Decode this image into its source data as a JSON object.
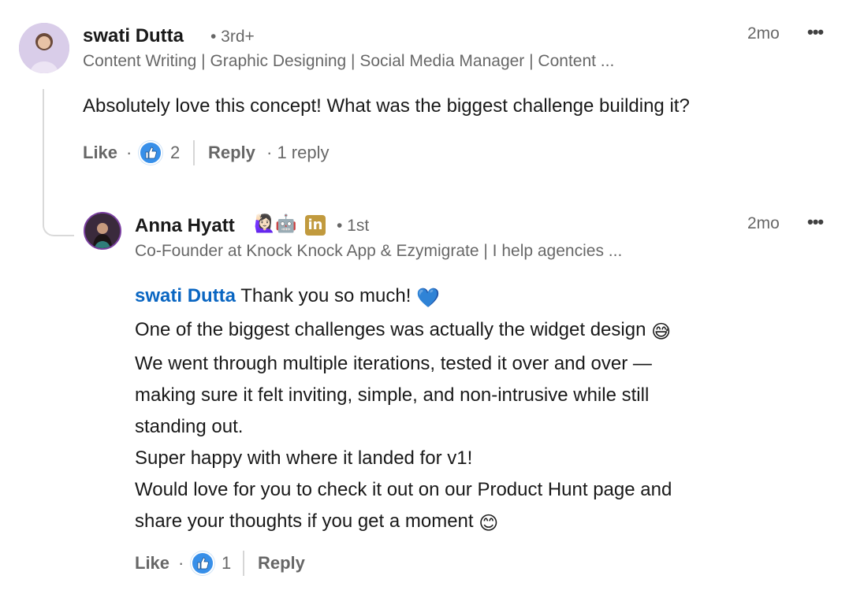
{
  "comment": {
    "author": "swati Dutta",
    "degree": "• 3rd+",
    "headline": "Content Writing | Graphic Designing | Social Media Manager | Content ...",
    "time": "2mo",
    "more_icon": "more-horizontal-icon",
    "text": "Absolutely love this concept! What was the biggest challenge building it?",
    "like_label": "Like",
    "like_sep": "·",
    "reaction_icon": "like-reaction-icon",
    "reaction_count": "2",
    "reply_label": "Reply",
    "replies_count": "· 1 reply"
  },
  "reply": {
    "author": "Anna Hyatt",
    "author_emojis": "🙋🏻‍♀️🤖",
    "linkedin_badge": "in",
    "degree": "• 1st",
    "headline": "Co-Founder at Knock Knock App & Ezymigrate | I help agencies ...",
    "time": "2mo",
    "more_icon": "more-horizontal-icon",
    "mention": "swati Dutta",
    "lines": [
      " Thank you so much! ",
      " One of the biggest challenges was actually the widget design ",
      " We went through multiple iterations, tested it over and over —",
      "making sure it felt inviting, simple, and non-intrusive while still",
      "standing out.",
      "Super happy with where it landed for v1!",
      " Would love for you to check it out on our Product Hunt page and",
      "share your thoughts if you get a moment "
    ],
    "emoji_heart": "💙",
    "emoji_sweat": "😅",
    "emoji_smile": "😊",
    "like_label": "Like",
    "like_sep": "·",
    "reaction_icon": "like-reaction-icon",
    "reaction_count": "1",
    "reply_label": "Reply"
  },
  "colors": {
    "mention": "#0a66c2",
    "like_badge": "#378fe9",
    "linkedin_badge": "#c19a3e"
  }
}
